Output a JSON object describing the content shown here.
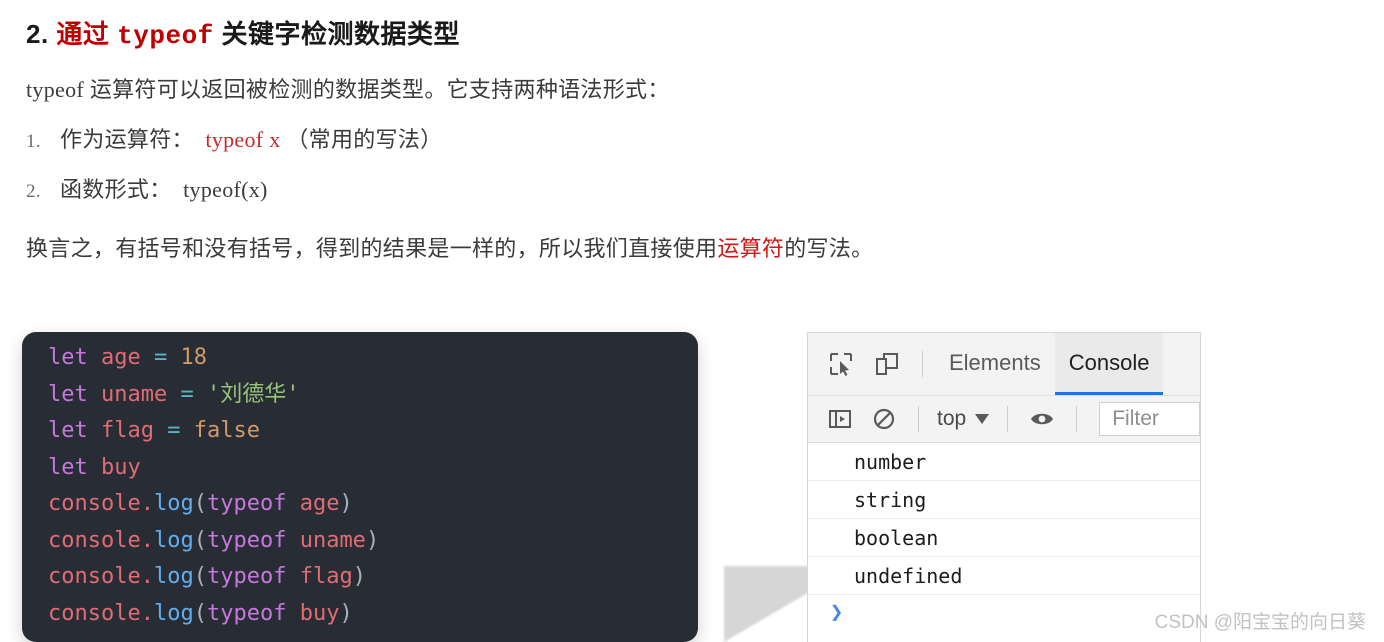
{
  "article": {
    "heading": {
      "number": "2.",
      "red_prefix": "通过",
      "red_keyword": "typeof",
      "rest": "关键字检测数据类型"
    },
    "intro_paragraph": {
      "keyword": "typeof",
      "text": "运算符可以返回被检测的数据类型。它支持两种语法形式："
    },
    "list": [
      {
        "marker": "1.",
        "label": "作为运算符：",
        "code": "typeof x",
        "code_color": "#c42b2b",
        "suffix": "（常用的写法）"
      },
      {
        "marker": "2.",
        "label": "函数形式：",
        "code": "typeof(x)",
        "code_color": "#3b3b3b",
        "suffix": ""
      }
    ],
    "conclusion": {
      "before": "换言之，有括号和没有括号，得到的结果是一样的，所以我们直接使用",
      "highlight": "运算符",
      "after": "的写法。",
      "highlight_color": "#d41515"
    }
  },
  "code_block": {
    "theme": "one-dark",
    "background": "#282c34",
    "lines": [
      {
        "tokens": [
          {
            "t": "let",
            "c": "kw"
          },
          {
            "t": " ",
            "c": "punct"
          },
          {
            "t": "age",
            "c": "var"
          },
          {
            "t": " ",
            "c": "punct"
          },
          {
            "t": "=",
            "c": "op"
          },
          {
            "t": " ",
            "c": "punct"
          },
          {
            "t": "18",
            "c": "num"
          }
        ]
      },
      {
        "tokens": [
          {
            "t": "let",
            "c": "kw"
          },
          {
            "t": " ",
            "c": "punct"
          },
          {
            "t": "uname",
            "c": "var"
          },
          {
            "t": " ",
            "c": "punct"
          },
          {
            "t": "=",
            "c": "op"
          },
          {
            "t": " ",
            "c": "punct"
          },
          {
            "t": "'刘德华'",
            "c": "str"
          }
        ]
      },
      {
        "tokens": [
          {
            "t": "let",
            "c": "kw"
          },
          {
            "t": " ",
            "c": "punct"
          },
          {
            "t": "flag",
            "c": "var"
          },
          {
            "t": " ",
            "c": "punct"
          },
          {
            "t": "=",
            "c": "op"
          },
          {
            "t": " ",
            "c": "punct"
          },
          {
            "t": "false",
            "c": "bool"
          }
        ]
      },
      {
        "tokens": [
          {
            "t": "let",
            "c": "kw"
          },
          {
            "t": " ",
            "c": "punct"
          },
          {
            "t": "buy",
            "c": "var"
          }
        ]
      },
      {
        "tokens": [
          {
            "t": "console",
            "c": "obj"
          },
          {
            "t": ".",
            "c": "dot"
          },
          {
            "t": "log",
            "c": "fn"
          },
          {
            "t": "(",
            "c": "punct"
          },
          {
            "t": "typeof",
            "c": "kw"
          },
          {
            "t": " ",
            "c": "punct"
          },
          {
            "t": "age",
            "c": "var"
          },
          {
            "t": ")",
            "c": "punct"
          }
        ]
      },
      {
        "tokens": [
          {
            "t": "console",
            "c": "obj"
          },
          {
            "t": ".",
            "c": "dot"
          },
          {
            "t": "log",
            "c": "fn"
          },
          {
            "t": "(",
            "c": "punct"
          },
          {
            "t": "typeof",
            "c": "kw"
          },
          {
            "t": " ",
            "c": "punct"
          },
          {
            "t": "uname",
            "c": "var"
          },
          {
            "t": ")",
            "c": "punct"
          }
        ]
      },
      {
        "tokens": [
          {
            "t": "console",
            "c": "obj"
          },
          {
            "t": ".",
            "c": "dot"
          },
          {
            "t": "log",
            "c": "fn"
          },
          {
            "t": "(",
            "c": "punct"
          },
          {
            "t": "typeof",
            "c": "kw"
          },
          {
            "t": " ",
            "c": "punct"
          },
          {
            "t": "flag",
            "c": "var"
          },
          {
            "t": ")",
            "c": "punct"
          }
        ]
      },
      {
        "tokens": [
          {
            "t": "console",
            "c": "obj"
          },
          {
            "t": ".",
            "c": "dot"
          },
          {
            "t": "log",
            "c": "fn"
          },
          {
            "t": "(",
            "c": "punct"
          },
          {
            "t": "typeof",
            "c": "kw"
          },
          {
            "t": " ",
            "c": "punct"
          },
          {
            "t": "buy",
            "c": "var"
          },
          {
            "t": ")",
            "c": "punct"
          }
        ]
      }
    ]
  },
  "devtools": {
    "tabs": [
      {
        "label": "Elements",
        "active": false
      },
      {
        "label": "Console",
        "active": true
      }
    ],
    "tab_icons": [
      "inspect-element-icon",
      "device-toolbar-icon"
    ],
    "active_tab_underline_color": "#1a73e8",
    "toolbar": {
      "sidebar_toggle_icon": "console-sidebar-icon",
      "clear_console_icon": "clear-console-icon",
      "context_label": "top",
      "eye_icon": "live-expression-eye-icon",
      "filter_placeholder": "Filter"
    },
    "console_output": [
      "number",
      "string",
      "boolean",
      "undefined"
    ],
    "prompt_symbol": "❯"
  },
  "watermark": "CSDN @阳宝宝的向日葵"
}
